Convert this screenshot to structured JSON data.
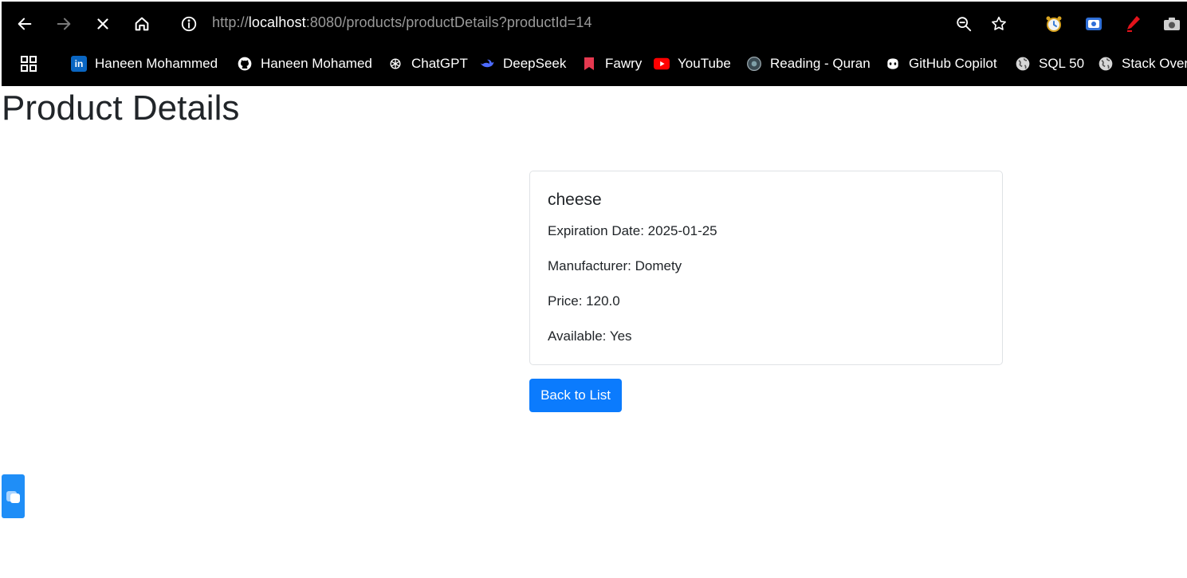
{
  "browser": {
    "url_prefix": "http://",
    "url_host": "localhost",
    "url_rest": ":8080/products/productDetails?productId=14",
    "icons": {
      "back": "arrow-left-icon",
      "forward": "arrow-right-icon",
      "stop": "close-icon",
      "home": "home-icon",
      "info": "info-icon",
      "zoom": "zoom-out-icon",
      "bookmark": "star-icon"
    },
    "bookmarks": [
      {
        "label": "Haneen Mohammed",
        "icon": "linkedin-icon"
      },
      {
        "label": "Haneen Mohamed",
        "icon": "github-icon"
      },
      {
        "label": "ChatGPT",
        "icon": "chatgpt-icon"
      },
      {
        "label": "DeepSeek",
        "icon": "deepseek-icon"
      },
      {
        "label": "Fawry",
        "icon": "bookmark-red-icon"
      },
      {
        "label": "YouTube",
        "icon": "youtube-icon"
      },
      {
        "label": "Reading - Quran",
        "icon": "quran-icon"
      },
      {
        "label": "GitHub Copilot",
        "icon": "copilot-icon"
      },
      {
        "label": "SQL 50",
        "icon": "globe-icon"
      },
      {
        "label": "Stack Overf",
        "icon": "globe-icon"
      }
    ]
  },
  "page": {
    "title": "Product Details",
    "product": {
      "name": "cheese",
      "expiration": "Expiration Date: 2025-01-25",
      "manufacturer": "Manufacturer: Domety",
      "price": "Price: 120.0",
      "available": "Available: Yes"
    },
    "back_button": "Back to List"
  },
  "colors": {
    "chrome_bg": "#000000",
    "primary_button": "#0b7bfd",
    "card_border": "#dfe2e5",
    "widget": "#1f8ef7"
  }
}
